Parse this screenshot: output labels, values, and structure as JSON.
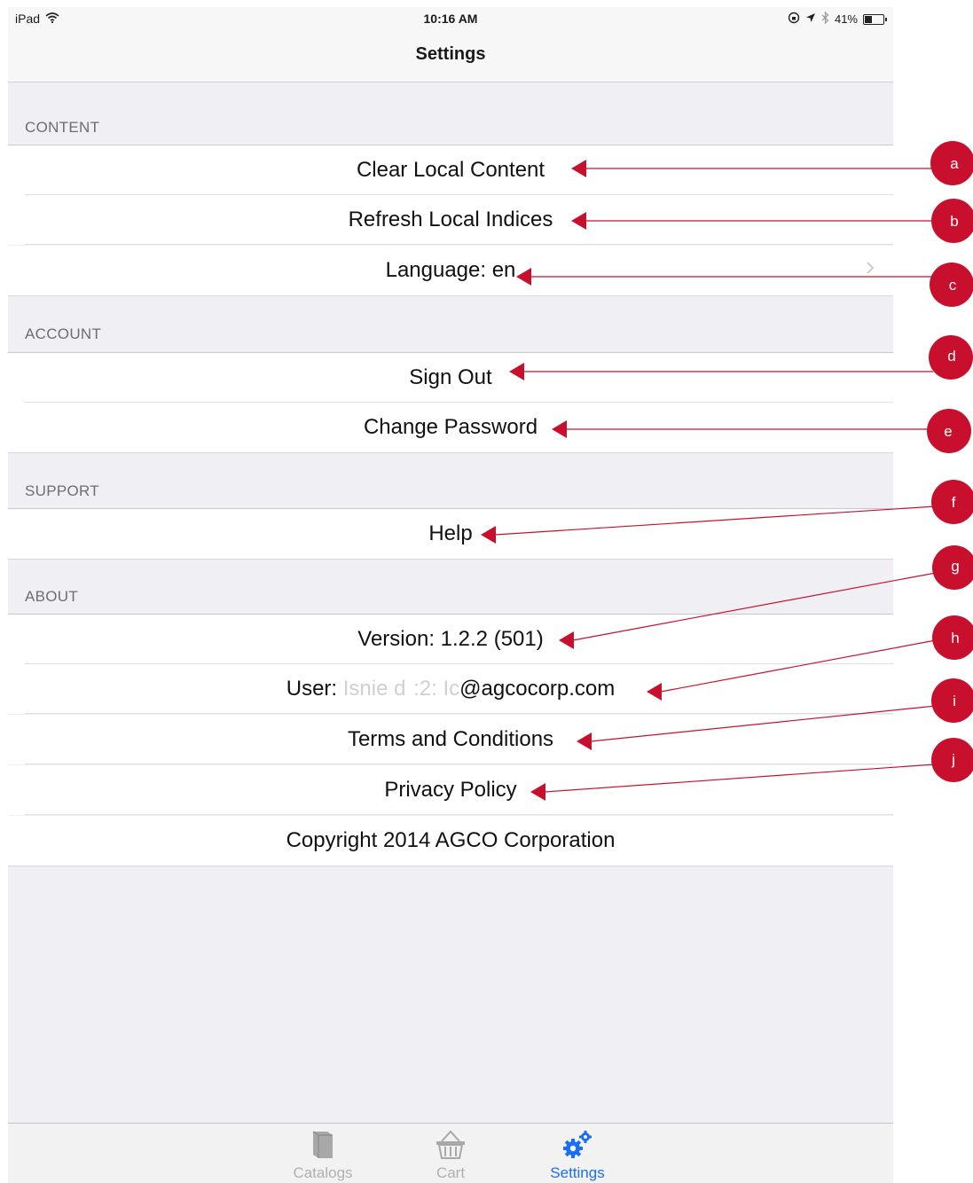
{
  "status_bar": {
    "device": "iPad",
    "time": "10:16 AM",
    "battery": "41%",
    "battery_level": 0.41
  },
  "nav": {
    "title": "Settings"
  },
  "sections": {
    "content": {
      "header": "CONTENT",
      "items": [
        {
          "label": "Clear Local Content"
        },
        {
          "label": "Refresh Local Indices"
        },
        {
          "label": "Language: en"
        }
      ]
    },
    "account": {
      "header": "ACCOUNT",
      "items": [
        {
          "label": "Sign Out"
        },
        {
          "label": "Change Password"
        }
      ]
    },
    "support": {
      "header": "SUPPORT",
      "items": [
        {
          "label": "Help"
        }
      ]
    },
    "about": {
      "header": "ABOUT",
      "items": [
        {
          "label": "Version: 1.2.2 (501)"
        },
        {
          "prefix": "User:",
          "blurred": "Isnie d  :2: Ic",
          "suffix": "@agcocorp.com"
        },
        {
          "label": "Terms and Conditions"
        },
        {
          "label": "Privacy Policy"
        },
        {
          "label": "Copyright 2014 AGCO Corporation"
        }
      ]
    }
  },
  "tabs": [
    {
      "label": "Catalogs",
      "icon": "book-icon",
      "active": false
    },
    {
      "label": "Cart",
      "icon": "basket-icon",
      "active": false
    },
    {
      "label": "Settings",
      "icon": "gears-icon",
      "active": true
    }
  ],
  "annotations": [
    "a",
    "b",
    "c",
    "d",
    "e",
    "f",
    "g",
    "h",
    "i",
    "j"
  ],
  "colors": {
    "annotation": "#c8102e",
    "tab_active": "#1a6ff0",
    "background": "#efeff4"
  }
}
